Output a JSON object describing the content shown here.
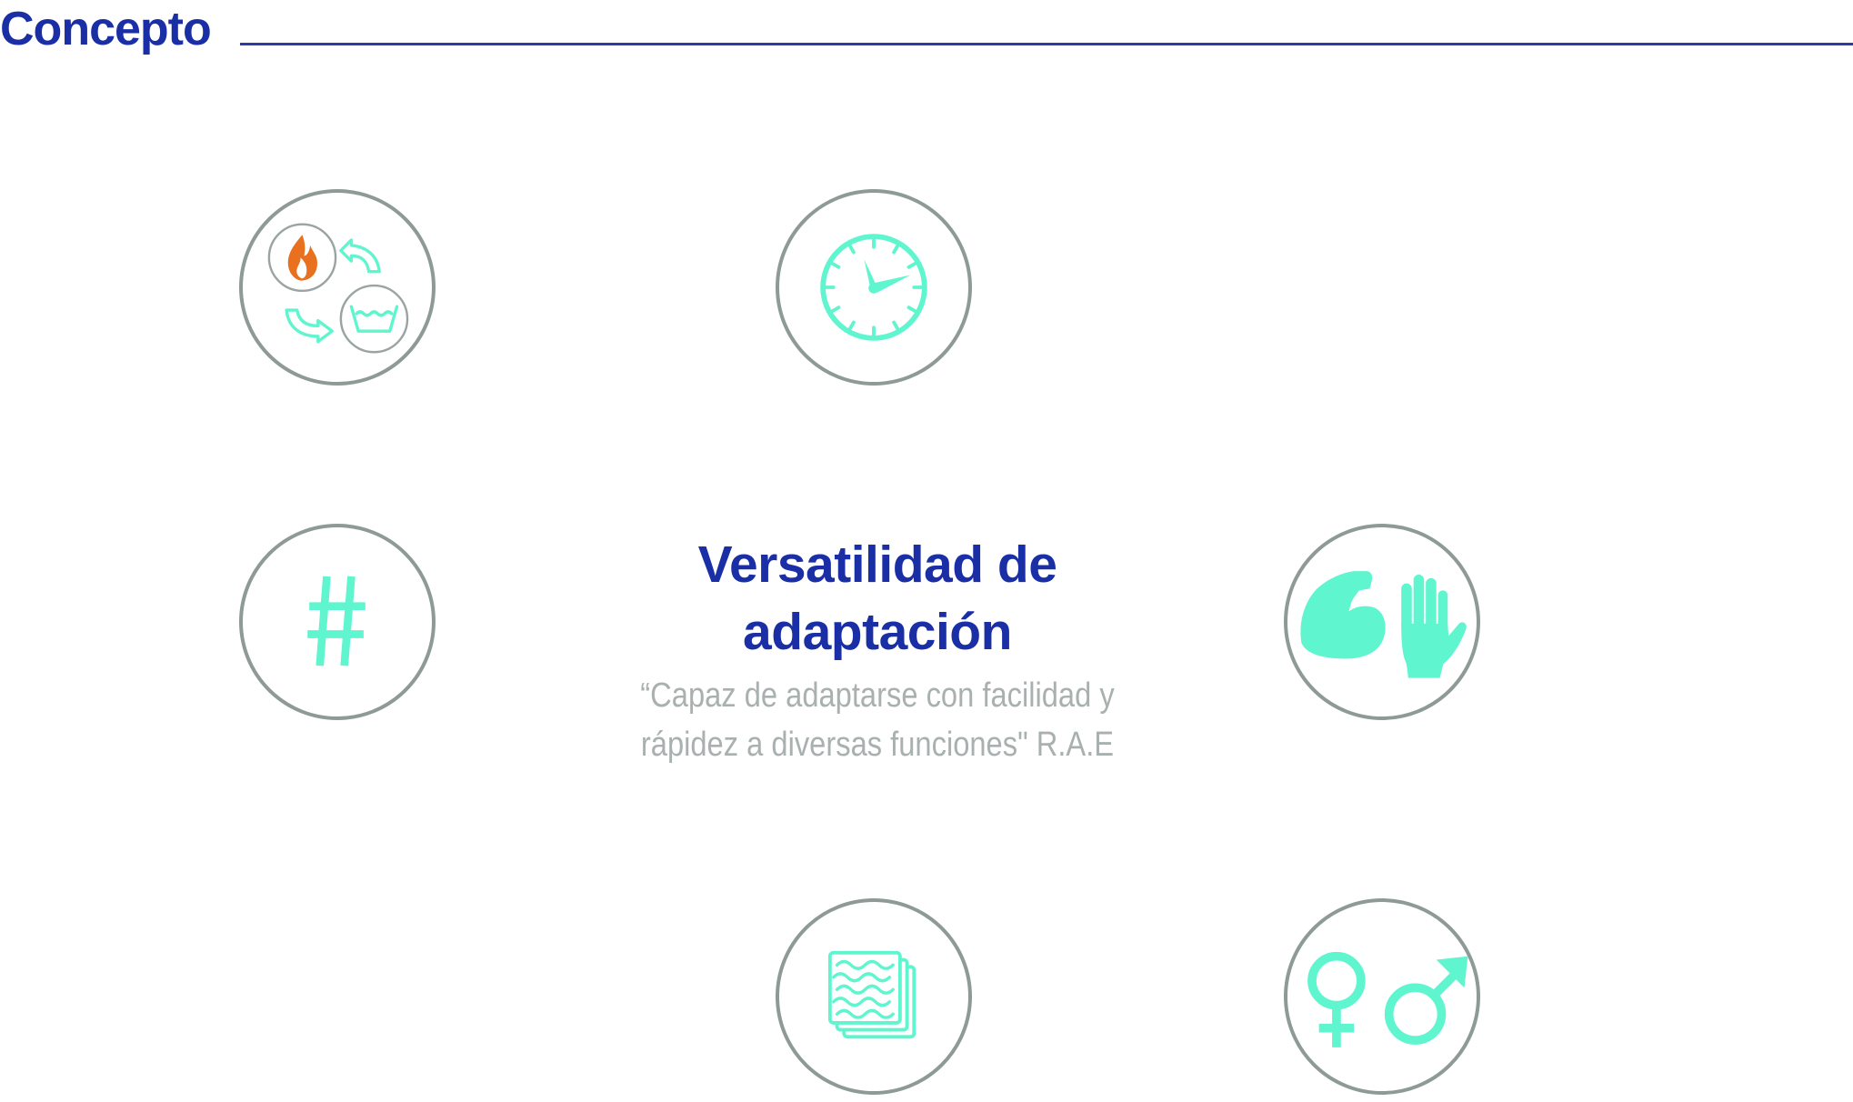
{
  "header": {
    "title": "Concepto"
  },
  "center": {
    "title_line1": "Versatilidad de",
    "title_line2": "adaptación",
    "quote_line1": "“Capaz de adaptarse con facilidad y",
    "quote_line2": "rápidez a diversas funciones\" R.A.E"
  },
  "nodes": [
    {
      "name": "laundry-cycle",
      "icons": [
        "fire-icon",
        "cycle-arrows-icon",
        "wash-basin-icon"
      ]
    },
    {
      "name": "time",
      "icons": [
        "clock-icon"
      ]
    },
    {
      "name": "hashtag",
      "icons": [
        "hashtag-icon"
      ]
    },
    {
      "name": "strength-hand",
      "icons": [
        "flexed-bicep-icon",
        "hand-icon"
      ]
    },
    {
      "name": "fabric-layers",
      "icons": [
        "fabric-swatches-icon"
      ]
    },
    {
      "name": "gender",
      "icons": [
        "female-symbol-icon",
        "male-symbol-icon"
      ]
    }
  ],
  "colors": {
    "brand_blue": "#1a2fa6",
    "rule_blue": "#2a3aa8",
    "circle_gray": "#8e9a97",
    "icon_aqua": "#5ff5cf",
    "icon_orange": "#e8701e",
    "quote_gray": "#a9b1b0",
    "inner_circle_gray": "#9aa4a2"
  }
}
